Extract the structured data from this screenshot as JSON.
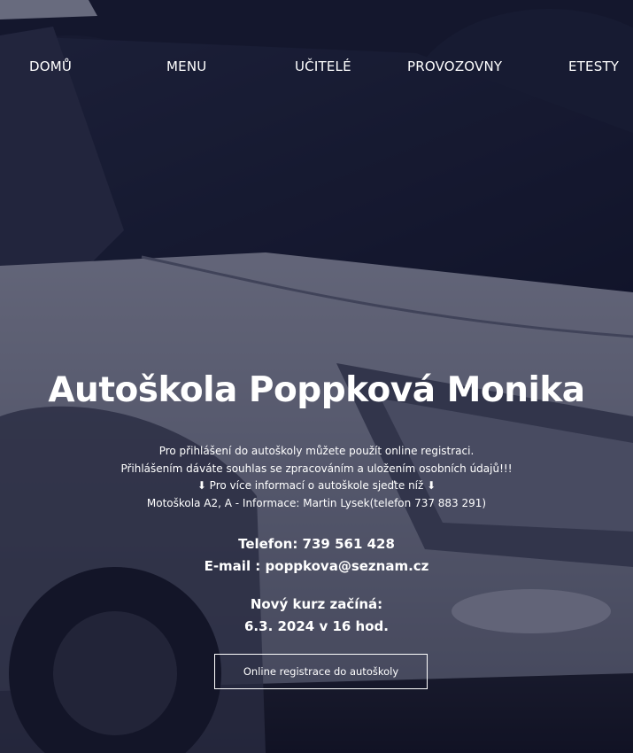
{
  "nav": {
    "home": "DOMŮ",
    "menu": "MENU",
    "teachers": "UČITELÉ",
    "branches": "PROVOZOVNY",
    "etests": "ETESTY"
  },
  "hero": {
    "title": "Autoškola Poppková Monika",
    "info_lines": [
      "Pro přihlášení do autoškoly můžete použít online registraci.",
      "Přihlášením dáváte souhlas se zpracováním a uložením osobních údajů!!!",
      "⬇ Pro více informací o autoškole sjeďte níž ⬇",
      "Motoškola A2, A - Informace: Martin Lysek(telefon 737 883 291)"
    ],
    "phone": "Telefon: 739 561 428",
    "email": "E-mail : poppkova@seznam.cz",
    "course_heading": "Nový kurz začíná:",
    "course_date": "6.3. 2024 v 16 hod.",
    "cta_label": "Online registrace do autoškoly"
  },
  "colors": {
    "overlay": "#0e112c",
    "text": "#ffffff"
  }
}
